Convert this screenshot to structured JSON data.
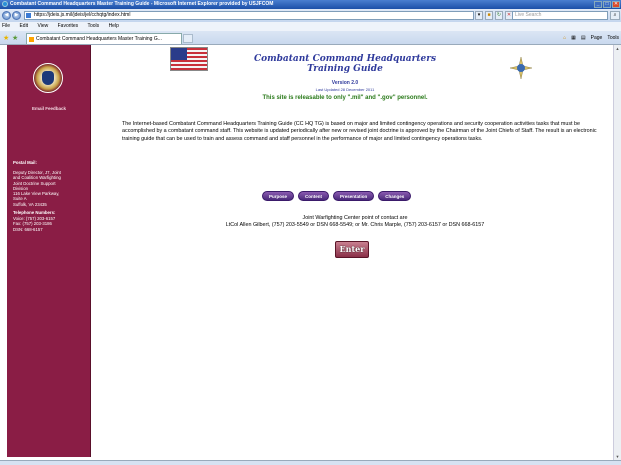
{
  "window": {
    "title": "Combatant Command Headquarters Master Training Guide - Microsoft Internet Explorer provided by USJFCOM",
    "controls": [
      "_",
      "□",
      "✕"
    ]
  },
  "address": {
    "url": "https://jdeis.js.mil/jdeis/jel/cchqtg/index.html",
    "search_placeholder": "Live Search"
  },
  "menu": [
    "File",
    "Edit",
    "View",
    "Favorites",
    "Tools",
    "Help"
  ],
  "tab": {
    "label": "Combatant Command Headquarters Master Training G..."
  },
  "command_bar": {
    "page": "Page",
    "tools": "Tools"
  },
  "sidebar": {
    "email_link": "Email Feedback",
    "postal_heading": "Postal Mail:",
    "postal_lines": [
      "Deputy Director, J7, Joint",
      "and Coalition Warfighting",
      "Joint Doctrine Support",
      "Division",
      "116 Lake View Parkway,",
      "Suite A",
      "Suffolk, VA 23435"
    ],
    "phone_heading": "Telephone Numbers:",
    "phone_lines": [
      "Voice: (757) 203-6157",
      "Fax: (757) 203-3186",
      "DSN: 668-6157"
    ]
  },
  "header": {
    "title_line1": "Combatant Command Headquarters",
    "title_line2": "Training Guide",
    "version": "Version 2.0",
    "updated": "Last Updated 28 December 2011",
    "releasable": "This site is releasable to only \".mil\" and \".gov\" personnel."
  },
  "intro": "The Internet-based Combatant Command Headquarters Training Guide (CC HQ TG) is based on major and limited contingency operations and security cooperation activities tasks that must be accomplished by a combatant command staff. This website is updated periodically after new or revised joint doctrine is approved by the Chairman of the Joint Chiefs of Staff. The result is an electronic training guide that can be used to train and assess command and staff personnel in the performance of major and limited contingency operations tasks.",
  "nav_buttons": {
    "purpose": "Purpose",
    "content": "Content",
    "presentation": "Presentation",
    "changes": "Changes"
  },
  "contact": {
    "line1": "Joint Warfighting Center point of contact are",
    "line2": "LtCol Allen Gilbert, (757) 203-5549 or DSN 668-5549; or Mr. Chris Marple, (757) 203-6157 or DSN 668-6157"
  },
  "enter_label": "Enter",
  "colors": {
    "sidebar": "#8a1d45",
    "title": "#2f3a9c",
    "releasable": "#2a7a1a",
    "nav_button": "#5a2a8a"
  }
}
